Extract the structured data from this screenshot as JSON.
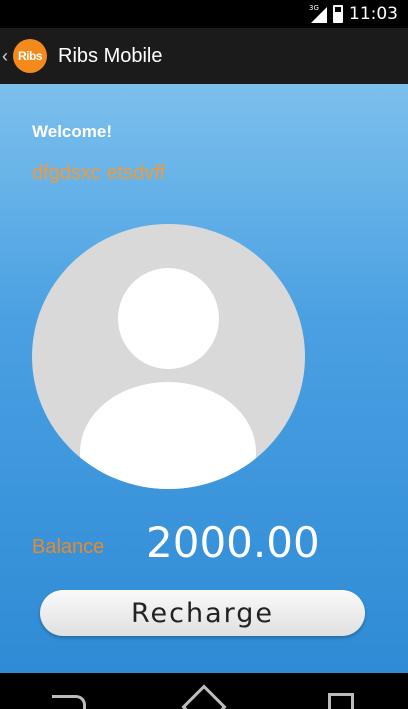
{
  "status_bar": {
    "network": "3G",
    "time": "11:03"
  },
  "action_bar": {
    "logo_text": "Ribs",
    "title": "Ribs Mobile"
  },
  "main": {
    "welcome": "Welcome!",
    "username": "dfgdsxc etsdvff",
    "balance_label": "Balance",
    "balance_value": "2000.00",
    "recharge_label": "Recharge"
  },
  "colors": {
    "accent": "#f09a3b",
    "background_top": "#7cc0ed",
    "background_bottom": "#2f8bd5"
  }
}
